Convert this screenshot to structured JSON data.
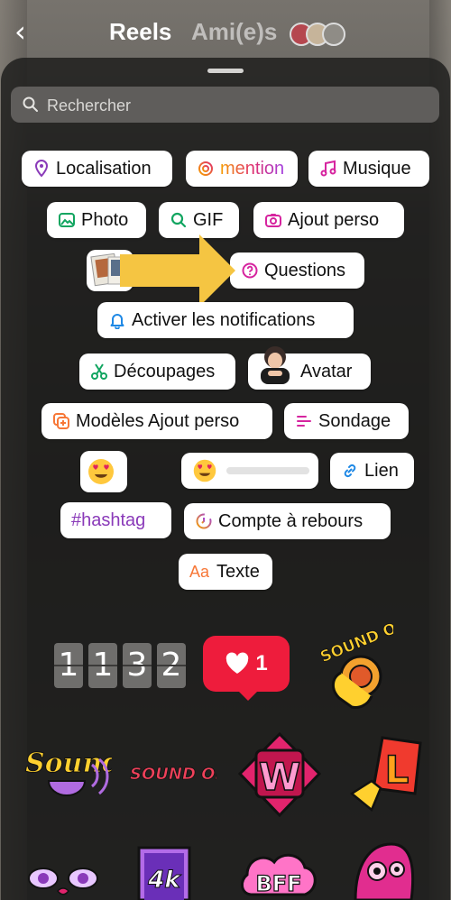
{
  "header": {
    "tab_reels": "Reels",
    "tab_amis": "Ami(e)s"
  },
  "search": {
    "placeholder": "Rechercher"
  },
  "stickers": {
    "localisation": "Localisation",
    "mention": "mention",
    "musique": "Musique",
    "photo": "Photo",
    "gif": "GIF",
    "ajout_perso": "Ajout perso",
    "questions": "Questions",
    "activer_notifications": "Activer les notifications",
    "decoupages": "Découpages",
    "avatar": "Avatar",
    "modeles_ajout_perso": "Modèles Ajout perso",
    "sondage": "Sondage",
    "lien": "Lien",
    "hashtag": "#hashtag",
    "compte_a_rebours": "Compte à rebours",
    "texte": "Texte",
    "texte_icon": "Aa"
  },
  "counter_digits": [
    "1",
    "1",
    "3",
    "2"
  ],
  "like_count": "1",
  "sticker_art": {
    "sound_on": "SOUND ON",
    "sound_on_2": "SOUND ON!",
    "sound_wave": "Sound",
    "w_letter": "W",
    "l_letter": "L",
    "k4": "4k",
    "bff": "BFF"
  },
  "colors": {
    "icon_purple": "#8a3ab9",
    "icon_pink": "#d6249f",
    "icon_green": "#11a560",
    "icon_blue": "#1e88e5",
    "icon_orange": "#f77737",
    "like_red": "#ee1c3c",
    "highlight_arrow": "#f5c542"
  }
}
